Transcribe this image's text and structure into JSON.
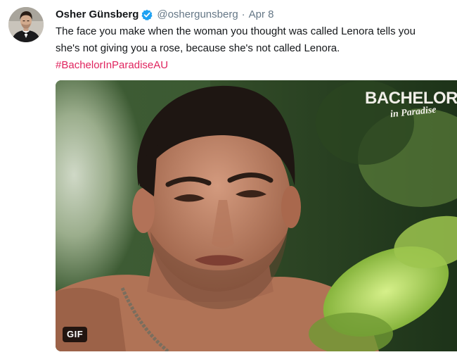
{
  "tweet": {
    "author_name": "Osher Günsberg",
    "verified_icon": "verified-badge-icon",
    "handle": "@oshergunsberg",
    "separator": "·",
    "date": "Apr 8",
    "text_line1": "The face you make when the woman you thought was called Lenora tells you",
    "text_line2": "she's not giving you a rose, because she's not called Lenora.",
    "hashtag": "#BachelorInParadiseAU"
  },
  "media": {
    "logo_main": "BACHELOR",
    "logo_script": "in Paradise",
    "gif_label": "GIF"
  },
  "colors": {
    "text": "#14171a",
    "secondary": "#657786",
    "hashtag": "#e0245e",
    "verified": "#1da1f2"
  }
}
